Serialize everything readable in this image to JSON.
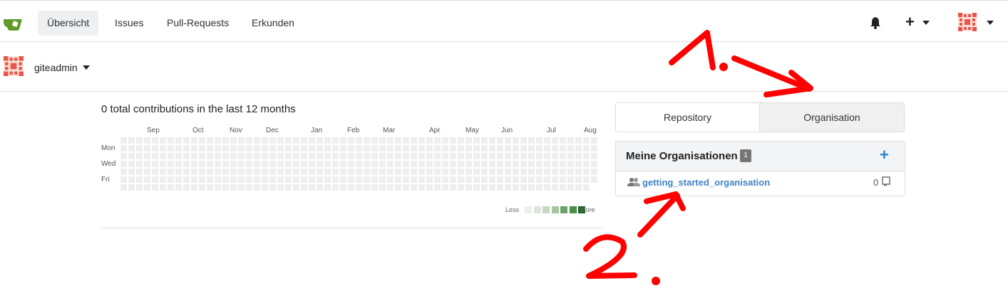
{
  "nav": {
    "items": [
      "Übersicht",
      "Issues",
      "Pull-Requests",
      "Erkunden"
    ],
    "active_index": 0
  },
  "user": {
    "name": "giteadmin"
  },
  "contributions": {
    "summary": "0 total contributions in the last 12 months",
    "months": [
      "Sep",
      "Oct",
      "Nov",
      "Dec",
      "Jan",
      "Feb",
      "Mar",
      "Apr",
      "May",
      "Jun",
      "Jul",
      "Aug"
    ],
    "days": [
      "Mon",
      "Wed",
      "Fri"
    ],
    "legend_less": "Less",
    "legend_more": "More",
    "legend_colors": [
      "#eeeeee",
      "#d6e685",
      "#8cc665",
      "#44a340",
      "#1e6823"
    ]
  },
  "tabs": {
    "repository": "Repository",
    "organisation": "Organisation"
  },
  "orgs": {
    "title": "Meine Organisationen",
    "count": "1",
    "items": [
      {
        "name": "getting_started_organisation",
        "repos": "0"
      }
    ]
  },
  "annotations": {
    "first": "1.",
    "second": "2."
  },
  "colors": {
    "link": "#4183c4",
    "accent": "#2185d0",
    "annotation": "#ff0000",
    "logo": "#609926"
  }
}
